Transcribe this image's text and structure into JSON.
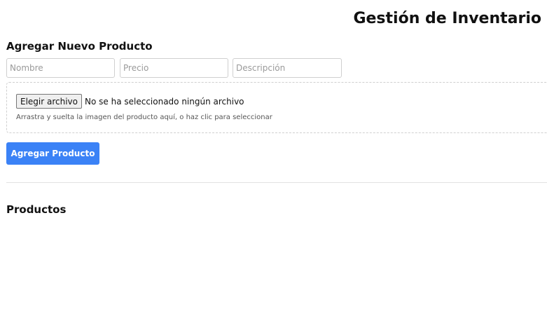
{
  "header": {
    "title": "Gestión de Inventario"
  },
  "add_product": {
    "title": "Agregar Nuevo Producto",
    "fields": {
      "name": {
        "placeholder": "Nombre",
        "value": ""
      },
      "price": {
        "placeholder": "Precio",
        "value": ""
      },
      "description": {
        "placeholder": "Descripción",
        "value": ""
      }
    },
    "file_input": {
      "button_label": "Elegir archivo",
      "status_text": "No se ha seleccionado ningún archivo",
      "hint": "Arrastra y suelta la imagen del producto aquí, o haz clic para seleccionar"
    },
    "submit_label": "Agregar Producto"
  },
  "products": {
    "title": "Productos",
    "items": []
  },
  "colors": {
    "accent": "#3b82f6",
    "border": "#cfcfcf",
    "divider": "#e2e2e2"
  }
}
